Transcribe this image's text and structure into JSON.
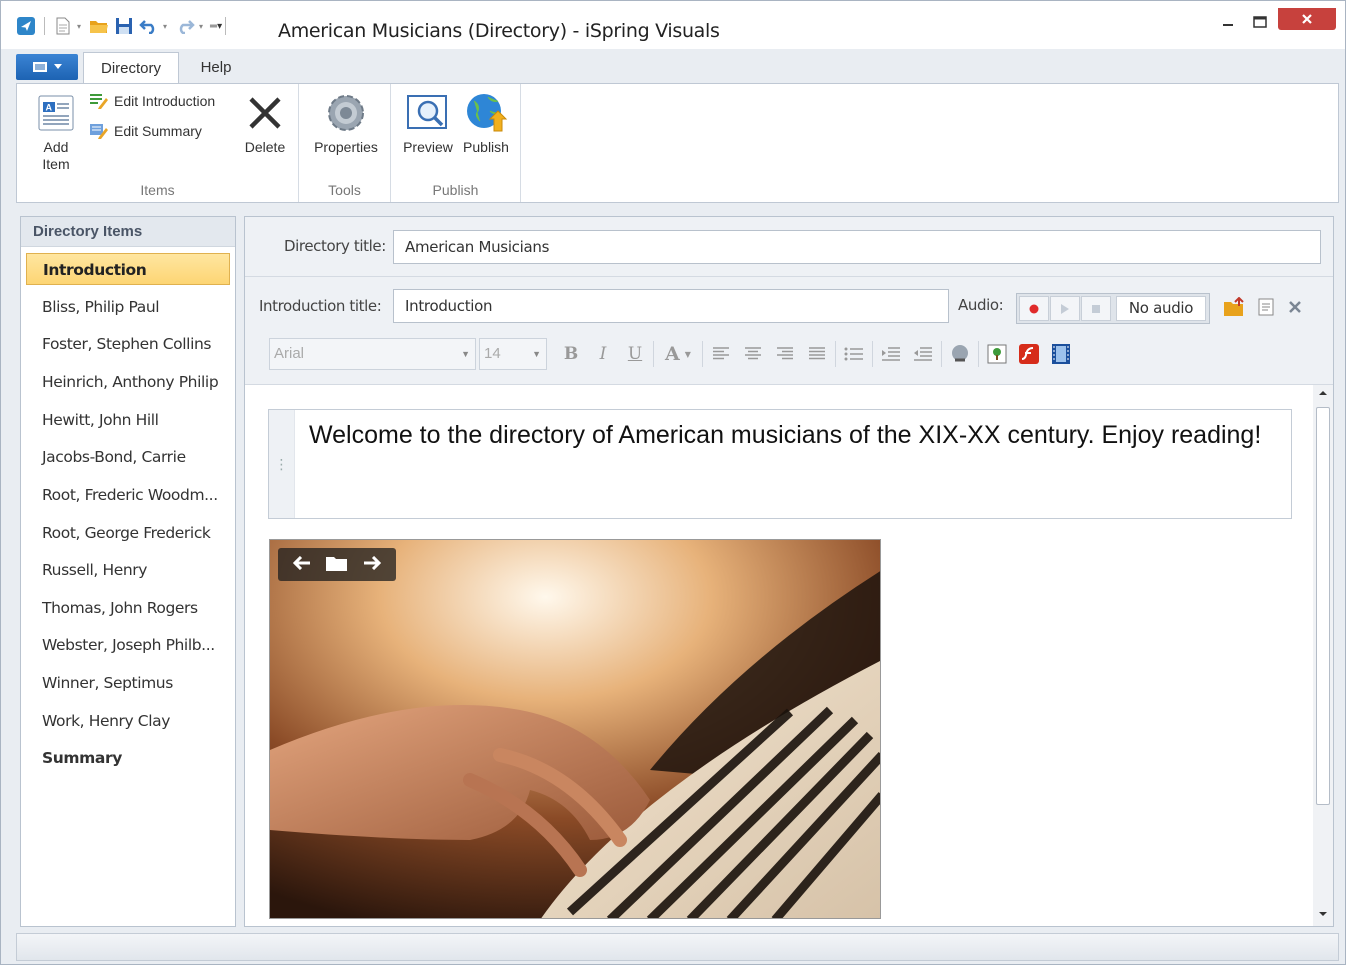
{
  "window": {
    "title": "American Musicians (Directory) - iSpring Visuals"
  },
  "ribbon": {
    "tabs": [
      {
        "label": "Directory",
        "active": true
      },
      {
        "label": "Help",
        "active": false
      }
    ],
    "groups": {
      "items": {
        "label": "Items",
        "add_item": [
          "Add",
          "Item"
        ],
        "edit_introduction": "Edit Introduction",
        "edit_summary": "Edit Summary",
        "delete": "Delete"
      },
      "tools": {
        "label": "Tools",
        "properties": "Properties"
      },
      "publish": {
        "label": "Publish",
        "preview": "Preview",
        "publish": "Publish"
      }
    }
  },
  "sidebar": {
    "header": "Directory Items",
    "items": [
      {
        "label": "Introduction",
        "active": true,
        "bold": true
      },
      {
        "label": "Bliss, Philip Paul"
      },
      {
        "label": "Foster, Stephen Collins"
      },
      {
        "label": "Heinrich, Anthony Philip"
      },
      {
        "label": "Hewitt, John Hill"
      },
      {
        "label": "Jacobs-Bond, Carrie"
      },
      {
        "label": "Root, Frederic Woodm..."
      },
      {
        "label": "Root, George Frederick"
      },
      {
        "label": "Russell, Henry"
      },
      {
        "label": "Thomas, John Rogers"
      },
      {
        "label": "Webster, Joseph Philb..."
      },
      {
        "label": "Winner, Septimus"
      },
      {
        "label": "Work, Henry Clay"
      },
      {
        "label": "Summary",
        "bold": true
      }
    ]
  },
  "editor": {
    "directory_title_label": "Directory title:",
    "directory_title_value": "American Musicians",
    "intro_title_label": "Introduction title:",
    "intro_title_value": "Introduction",
    "audio_label": "Audio:",
    "audio_status": "No audio",
    "font_family": "Arial",
    "font_size": "14",
    "body_text": "Welcome to the directory of American musicians of the XIX-XX century. Enjoy reading!",
    "image_description": "piano-hands-photo"
  },
  "colors": {
    "accent": "#1d63b3",
    "selected_item": "#fdd574",
    "close_button": "#c7413d"
  }
}
